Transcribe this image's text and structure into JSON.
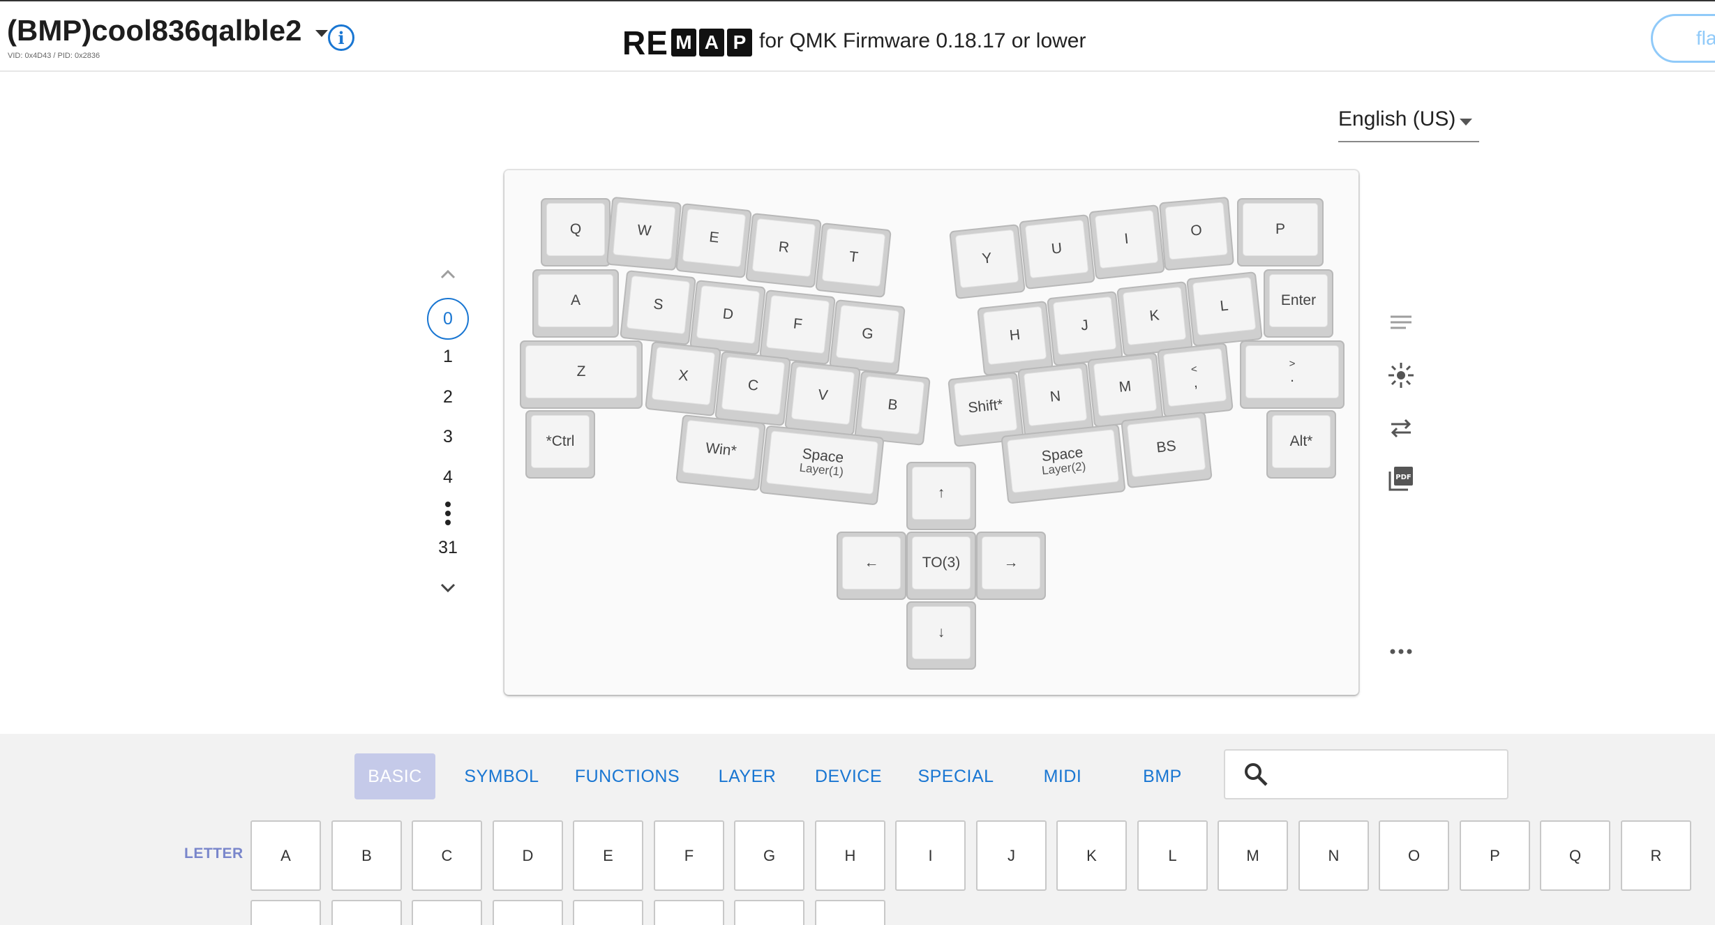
{
  "header": {
    "keyboard_name": "(BMP)cool836qalble2",
    "vid_pid": "VID: 0x4D43 / PID: 0x2836",
    "logo_re": "RE",
    "logo_letters": [
      "M",
      "A",
      "P"
    ],
    "subtitle": "for QMK Firmware 0.18.17 or lower",
    "flash_label": "fla"
  },
  "language": {
    "selected": "English (US)"
  },
  "layers": {
    "items": [
      "0",
      "1",
      "2",
      "3",
      "4"
    ],
    "active": "0",
    "last": "31"
  },
  "keys": {
    "q": "Q",
    "w": "W",
    "e": "E",
    "r": "R",
    "t": "T",
    "y": "Y",
    "u": "U",
    "i": "I",
    "o": "O",
    "p": "P",
    "a": "A",
    "s": "S",
    "d": "D",
    "f": "F",
    "g": "G",
    "h": "H",
    "j": "J",
    "k": "K",
    "l": "L",
    "enter": "Enter",
    "z": "Z",
    "x": "X",
    "c": "C",
    "v": "V",
    "b": "B",
    "shift": "Shift*",
    "n": "N",
    "m": "M",
    "comma_top": "<",
    "comma_bottom": ",",
    "period_top": ">",
    "period_bottom": ".",
    "ctrl": "*Ctrl",
    "win": "Win*",
    "space_left": "Space",
    "space_left_sub": "Layer(1)",
    "space_right": "Space",
    "space_right_sub": "Layer(2)",
    "bs": "BS",
    "alt": "Alt*",
    "up": "↑",
    "left": "←",
    "to3": "TO(3)",
    "right": "→",
    "down": "↓"
  },
  "palette": {
    "tabs": [
      "BASIC",
      "SYMBOL",
      "FUNCTIONS",
      "LAYER",
      "DEVICE",
      "SPECIAL",
      "MIDI",
      "BMP"
    ],
    "active_tab": "BASIC",
    "search_placeholder": "",
    "row_label": "LETTER",
    "letters": [
      "A",
      "B",
      "C",
      "D",
      "E",
      "F",
      "G",
      "H",
      "I",
      "J",
      "K",
      "L",
      "M",
      "N",
      "O",
      "P",
      "Q",
      "R"
    ]
  },
  "colors": {
    "accent": "#1976d2",
    "tab_active_bg": "#c5cae9",
    "row_label": "#7986cb"
  }
}
